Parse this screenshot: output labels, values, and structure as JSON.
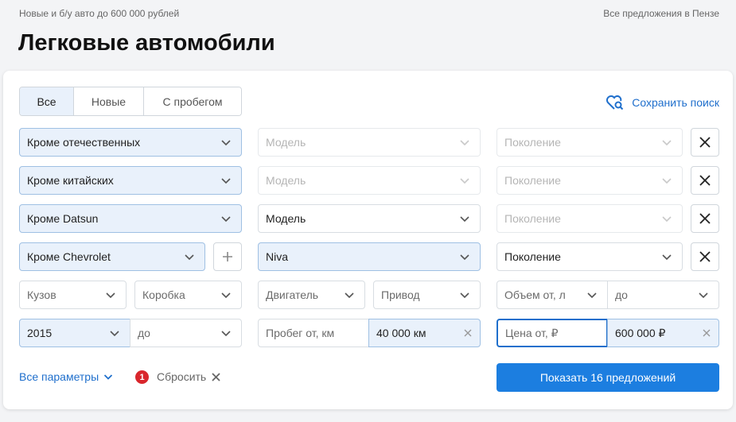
{
  "header": {
    "crumb": "Новые и б/у авто до 600 000 рублей",
    "region": "Все предложения в Пензе",
    "title": "Легковые автомобили"
  },
  "tabs": [
    {
      "label": "Все",
      "active": true
    },
    {
      "label": "Новые",
      "active": false
    },
    {
      "label": "С пробегом",
      "active": false
    }
  ],
  "save_search": {
    "label": "Сохранить поиск",
    "icon": "heart-search-icon"
  },
  "rows": [
    {
      "brand": "Кроме отечественных",
      "model_placeholder": "Модель",
      "generation_placeholder": "Поколение"
    },
    {
      "brand": "Кроме китайских",
      "model_placeholder": "Модель",
      "generation_placeholder": "Поколение"
    },
    {
      "brand": "Кроме Datsun",
      "model_placeholder": "Модель",
      "generation_placeholder": "Поколение"
    },
    {
      "brand": "Кроме Chevrolet",
      "model": "Niva",
      "generation_placeholder": "Поколение"
    }
  ],
  "filters": {
    "body": "Кузов",
    "gearbox": "Коробка",
    "engine": "Двигатель",
    "drive": "Привод",
    "volume_from": "Объем от, л",
    "volume_to": "до",
    "year_from": "2015",
    "year_to": "до",
    "mileage_from_placeholder": "Пробег от, км",
    "mileage_to": "40 000 км",
    "price_from_placeholder": "Цена от, ₽",
    "price_to": "600 000 ₽"
  },
  "footer": {
    "all_params": "Все параметры",
    "reset_count": "1",
    "reset": "Сбросить",
    "show": "Показать 16 предложений"
  },
  "colors": {
    "accent": "#1c7ee0",
    "link": "#1f6fcc",
    "badge": "#d9262c",
    "selected_bg": "#e9f1fb"
  }
}
